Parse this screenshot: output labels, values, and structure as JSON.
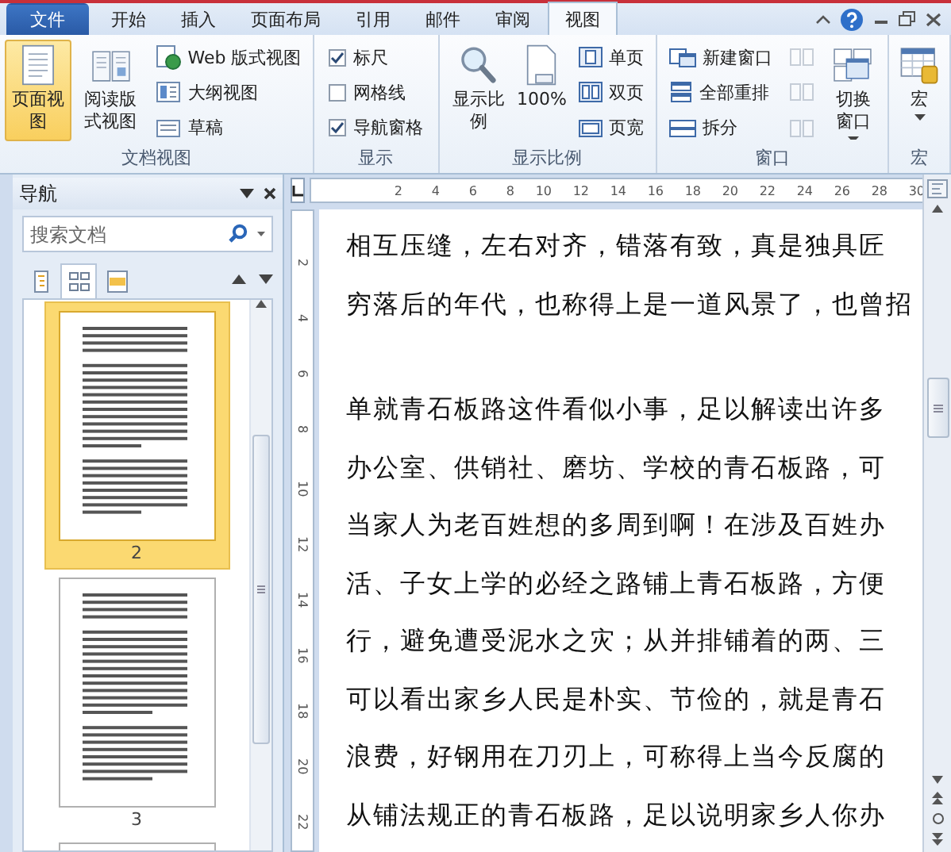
{
  "tabs": [
    {
      "label": "文件",
      "kind": "file",
      "selected": false
    },
    {
      "label": "开始",
      "kind": "tab",
      "selected": false
    },
    {
      "label": "插入",
      "kind": "tab",
      "selected": false
    },
    {
      "label": "页面布局",
      "kind": "tab",
      "selected": false
    },
    {
      "label": "引用",
      "kind": "tab",
      "selected": false
    },
    {
      "label": "邮件",
      "kind": "tab",
      "selected": false
    },
    {
      "label": "审阅",
      "kind": "tab",
      "selected": false
    },
    {
      "label": "视图",
      "kind": "tab",
      "selected": true
    }
  ],
  "ribbon": {
    "groups": [
      {
        "label": "文档视图",
        "columns": [
          {
            "kind": "large",
            "label": "页面视图",
            "selected": true
          },
          {
            "kind": "large",
            "label": "阅读版式视图",
            "selected": false
          },
          {
            "kind": "stack",
            "items": [
              {
                "label": "Web 版式视图"
              },
              {
                "label": "大纲视图"
              },
              {
                "label": "草稿"
              }
            ]
          }
        ]
      },
      {
        "label": "显示",
        "columns": [
          {
            "kind": "checks",
            "items": [
              {
                "label": "标尺",
                "checked": true
              },
              {
                "label": "网格线",
                "checked": false
              },
              {
                "label": "导航窗格",
                "checked": true
              }
            ]
          }
        ]
      },
      {
        "label": "显示比例",
        "columns": [
          {
            "kind": "large",
            "label": "显示比例",
            "selected": false
          },
          {
            "kind": "large",
            "label": "100%",
            "selected": false
          },
          {
            "kind": "stack",
            "items": [
              {
                "label": "单页"
              },
              {
                "label": "双页"
              },
              {
                "label": "页宽"
              }
            ]
          }
        ]
      },
      {
        "label": "窗口",
        "columns": [
          {
            "kind": "stack",
            "items": [
              {
                "label": "新建窗口"
              },
              {
                "label": "全部重排"
              },
              {
                "label": "拆分"
              }
            ]
          },
          {
            "kind": "iconstack",
            "items": [
              {
                "disabled": true
              },
              {
                "disabled": true
              },
              {
                "disabled": true
              }
            ]
          },
          {
            "kind": "large",
            "label": "切换窗口",
            "selected": false,
            "dropdown": true
          }
        ]
      },
      {
        "label": "宏",
        "columns": [
          {
            "kind": "large",
            "label": "宏",
            "selected": false,
            "dropdown": true
          }
        ]
      }
    ]
  },
  "navigation": {
    "title": "导航",
    "search": {
      "placeholder": "搜索文档"
    },
    "view_tabs": [
      {
        "selected": false
      },
      {
        "selected": true
      },
      {
        "selected": false
      }
    ],
    "pages": [
      {
        "label": "2",
        "selected": true
      },
      {
        "label": "3",
        "selected": false
      },
      {
        "selected": false
      }
    ]
  },
  "ruler": {
    "horizontal": [
      "2",
      "4",
      "6",
      "8",
      "10",
      "12",
      "14",
      "16",
      "18",
      "20",
      "22",
      "24",
      "26",
      "28",
      "30"
    ],
    "vertical": [
      "2",
      "4",
      "6",
      "8",
      "10",
      "12",
      "14",
      "16",
      "18",
      "20",
      "22"
    ]
  },
  "document": {
    "paragraphs": [
      [
        "相互压缝，左右对齐，错落有致，真是独具匠",
        "穷落后的年代，也称得上是一道风景了，也曾招"
      ],
      [
        "单就青石板路这件看似小事，足以解读出许多",
        "办公室、供销社、磨坊、学校的青石板路，可",
        "当家人为老百姓想的多周到啊！在涉及百姓办",
        "活、子女上学的必经之路铺上青石板路，方便",
        "行，避免遭受泥水之灾；从并排铺着的两、三",
        "可以看出家乡人民是朴实、节俭的，就是青石",
        "浪费，好钢用在刀刃上，可称得上当今反腐的",
        "从铺法规正的青石板路，足以说明家乡人你办"
      ]
    ]
  }
}
